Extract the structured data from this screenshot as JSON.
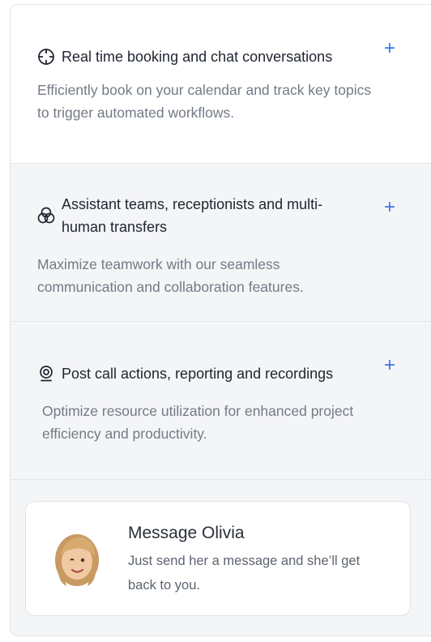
{
  "features": [
    {
      "title": "Real time booking and chat conversations",
      "description": "Efficiently book on your calendar and track key topics to trigger automated workflows.",
      "icon": "target-icon",
      "expand_label": "+"
    },
    {
      "title": "Assistant teams, receptionists and multi-human transfers",
      "description": "Maximize teamwork with our seamless communication and collaboration features.",
      "icon": "venn-circles-icon",
      "expand_label": "+"
    },
    {
      "title": "Post call actions, reporting and recordings",
      "description": "Optimize resource utilization for enhanced project efficiency and productivity.",
      "icon": "location-pin-icon",
      "expand_label": "+"
    }
  ],
  "message": {
    "title": "Message Olivia",
    "subtitle": "Just send her a message and she’ll get back to you.",
    "avatar": "memoji-avatar"
  },
  "colors": {
    "accent": "#3b74e6",
    "panel": "#f4f5f7",
    "active_panel": "#ffffff"
  }
}
